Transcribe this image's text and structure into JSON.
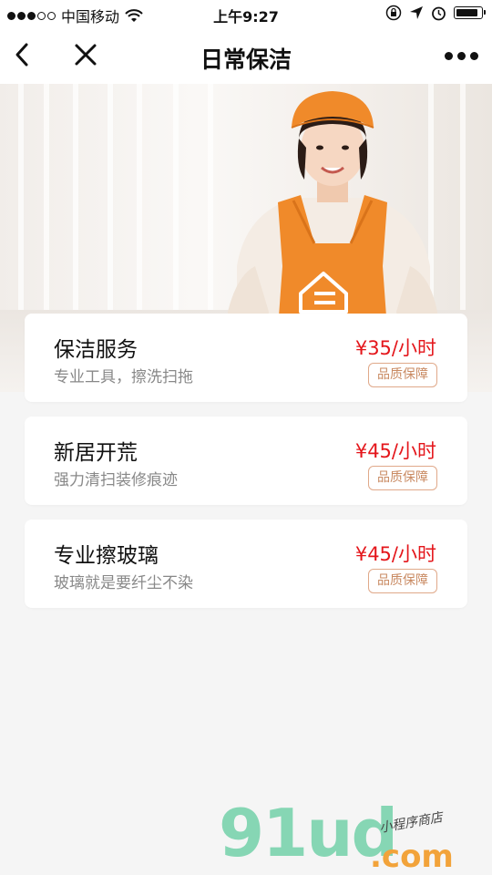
{
  "status_bar": {
    "carrier": "中国移动",
    "time": "上午9:27",
    "battery_level": 0.9
  },
  "nav": {
    "title": "日常保洁"
  },
  "services": [
    {
      "name": "保洁服务",
      "desc": "专业工具，擦洗扫拖",
      "price": "¥35/小时",
      "badge": "品质保障"
    },
    {
      "name": "新居开荒",
      "desc": "强力清扫装修痕迹",
      "price": "¥45/小时",
      "badge": "品质保障"
    },
    {
      "name": "专业擦玻璃",
      "desc": "玻璃就是要纤尘不染",
      "price": "¥45/小时",
      "badge": "品质保障"
    }
  ],
  "watermark": {
    "logo": "91ud",
    "domain": ".com",
    "slogan": "小程序商店"
  },
  "colors": {
    "price": "#e4161b",
    "badge": "#c98a62",
    "apron": "#f08a2a"
  },
  "icons": {
    "back": "chevron-left-icon",
    "close": "close-icon",
    "more": "more-dots-icon"
  }
}
